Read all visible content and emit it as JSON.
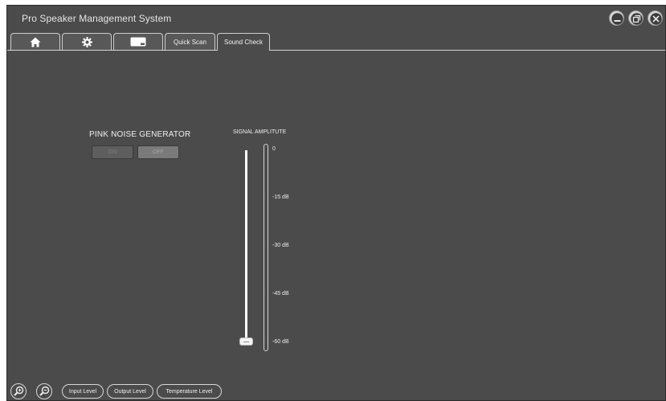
{
  "window": {
    "title": "Pro Speaker Management System"
  },
  "window_controls": [
    {
      "icon": "minimize-icon"
    },
    {
      "icon": "restore-icon"
    },
    {
      "icon": "close-icon"
    }
  ],
  "tabs": [
    {
      "icon": "home-icon"
    },
    {
      "icon": "settings-gear-icon"
    },
    {
      "icon": "device-icon"
    },
    {
      "label": "Quick Scan"
    },
    {
      "label": "Sound Check",
      "active": true
    }
  ],
  "pink_noise": {
    "label": "PINK NOISE GENERATOR",
    "on_label": "ON",
    "off_label": "OFF",
    "state": "OFF"
  },
  "signal": {
    "label": "SIGNAL AMPLITUTE",
    "ticks": [
      "0",
      "-15 dB",
      "-30 dB",
      "-45 dB",
      "-60 dB"
    ],
    "level_fraction": 0.0
  },
  "bottom": {
    "zoom_in_icon": "zoom-in-icon",
    "zoom_out_icon": "zoom-out-icon",
    "buttons": [
      "Input Level",
      "Output Level",
      "Temperature Level"
    ]
  },
  "colors": {
    "background": "#4b4b4b",
    "outline": "#d8d8d8"
  }
}
